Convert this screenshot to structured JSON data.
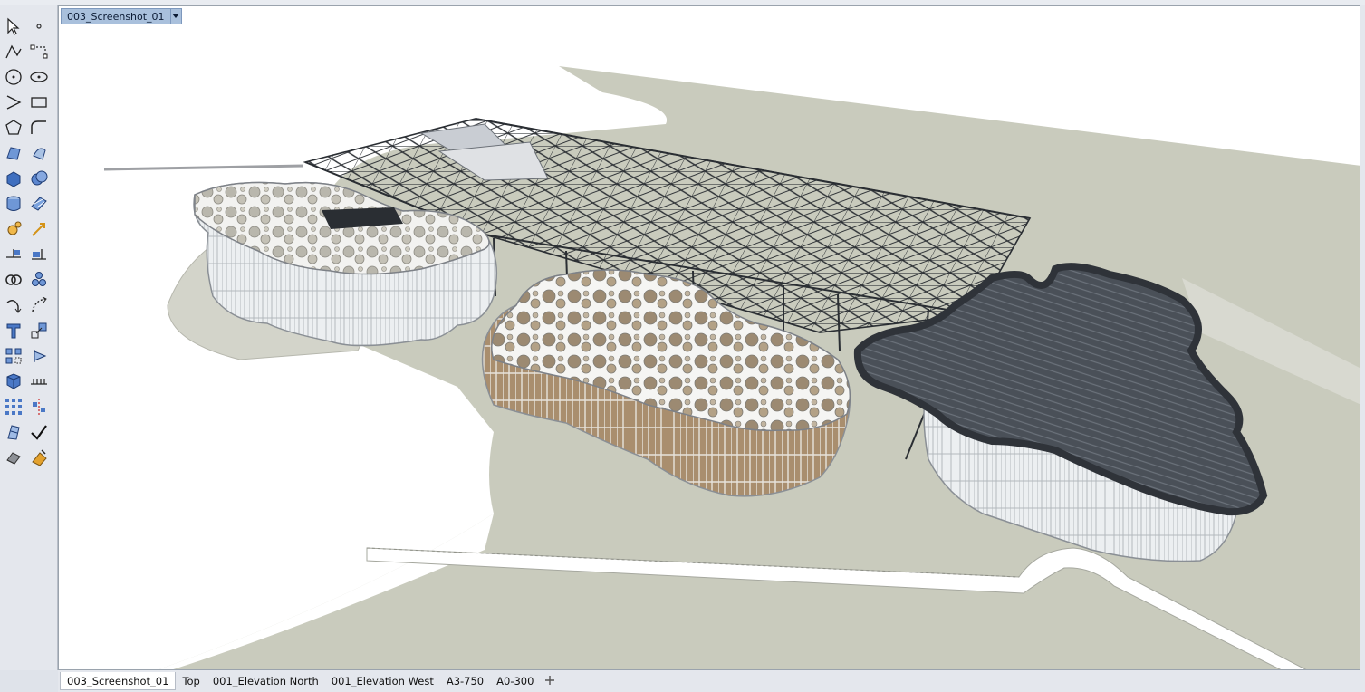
{
  "viewport": {
    "title": "003_Screenshot_01",
    "dropdown_icon": "chevron-down-icon"
  },
  "toolbar": {
    "tools": [
      {
        "name": "select-arrow-icon"
      },
      {
        "name": "point-icon"
      },
      {
        "name": "polyline-icon"
      },
      {
        "name": "curve-control-points-icon"
      },
      {
        "name": "circle-icon"
      },
      {
        "name": "ellipse-icon"
      },
      {
        "name": "arc-icon"
      },
      {
        "name": "rectangle-icon"
      },
      {
        "name": "polygon-icon"
      },
      {
        "name": "fillet-curve-icon"
      },
      {
        "name": "surface-from-points-icon"
      },
      {
        "name": "extrude-surface-icon"
      },
      {
        "name": "box-icon"
      },
      {
        "name": "boolean-union-icon"
      },
      {
        "name": "cylinder-icon"
      },
      {
        "name": "mesh-icon"
      },
      {
        "name": "gear-transform-icon"
      },
      {
        "name": "dimension-icon"
      },
      {
        "name": "trim-icon"
      },
      {
        "name": "split-icon"
      },
      {
        "name": "join-icon"
      },
      {
        "name": "group-icon"
      },
      {
        "name": "rotate-icon"
      },
      {
        "name": "rotate-3d-icon"
      },
      {
        "name": "text-icon"
      },
      {
        "name": "scale-icon"
      },
      {
        "name": "array-icon"
      },
      {
        "name": "mirror-icon"
      },
      {
        "name": "solid-tools-icon"
      },
      {
        "name": "grid-snap-icon"
      },
      {
        "name": "array-grid-icon"
      },
      {
        "name": "align-icon"
      },
      {
        "name": "analyze-icon"
      },
      {
        "name": "check-icon"
      },
      {
        "name": "render-icon"
      },
      {
        "name": "material-icon"
      }
    ]
  },
  "tabs": [
    {
      "label": "003_Screenshot_01",
      "active": true
    },
    {
      "label": "Top",
      "active": false
    },
    {
      "label": "001_Elevation North",
      "active": false
    },
    {
      "label": "001_Elevation West",
      "active": false
    },
    {
      "label": "A3-750",
      "active": false
    },
    {
      "label": "A0-300",
      "active": false
    }
  ],
  "add_tab_icon": "plus-icon",
  "colors": {
    "viewport_label_bg": "#a9c0dc",
    "ground": "#c9cbbd",
    "roof_dark": "#3c4047",
    "facade_wood": "#a98e6e",
    "truss": "#2a2e33"
  }
}
